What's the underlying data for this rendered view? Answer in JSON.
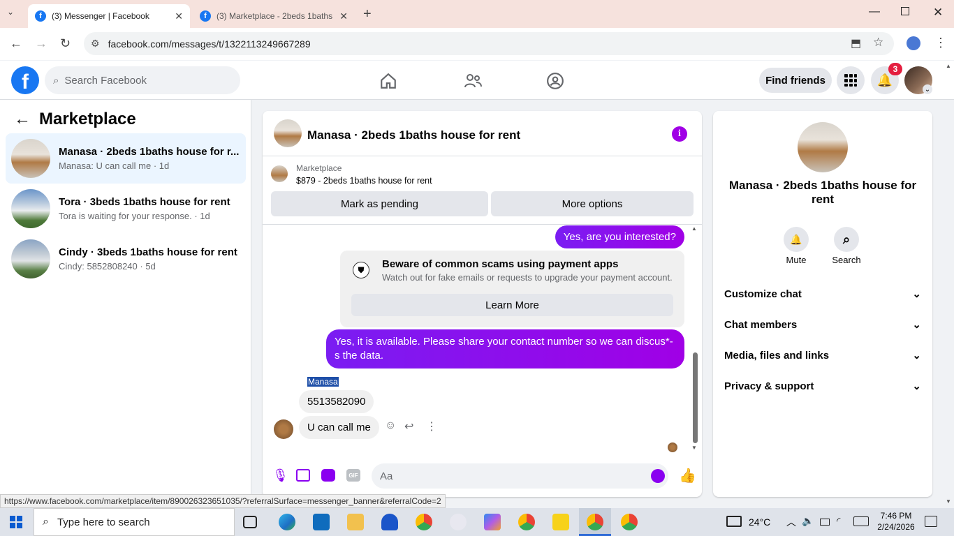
{
  "browser": {
    "tabs": [
      {
        "title": "(3) Messenger | Facebook"
      },
      {
        "title": "(3) Marketplace - 2beds 1baths"
      }
    ],
    "url": "facebook.com/messages/t/1322113249667289",
    "status_url": "https://www.facebook.com/marketplace/item/890026323651035/?referralSurface=messenger_banner&referralCode=2"
  },
  "header": {
    "search_placeholder": "Search Facebook",
    "find_friends": "Find friends",
    "notif_count": "3"
  },
  "left": {
    "title": "Marketplace",
    "conversations": [
      {
        "name": "Manasa · 2beds 1baths house for r...",
        "snippet": "Manasa: U can call me · 1d"
      },
      {
        "name": "Tora · 3beds 1baths house for rent",
        "snippet": "Tora is waiting for your response. · 1d"
      },
      {
        "name": "Cindy · 3beds 1baths house for rent",
        "snippet": "Cindy: 5852808240 · 5d"
      }
    ]
  },
  "chat": {
    "title": "Manasa · 2beds 1baths house for rent",
    "banner_label": "Marketplace",
    "banner_listing": "$879 - 2beds 1baths house for rent",
    "mark_pending": "Mark as pending",
    "more_options": "More options",
    "msg1": "Yes, are you interested?",
    "scam_title": "Beware of common scams using payment apps",
    "scam_body": "Watch out for fake emails or requests to upgrade your payment account.",
    "learn_more": "Learn More",
    "msg2": "Yes, it is available. Please share your contact number so we can discus*-s the data.",
    "sender": "Manasa",
    "msg3": "5513582090",
    "msg4": "U can call me",
    "composer_placeholder": "Aa"
  },
  "info": {
    "name": "Manasa · 2beds 1baths house for rent",
    "mute": "Mute",
    "search": "Search",
    "sections": [
      "Customize chat",
      "Chat members",
      "Media, files and links",
      "Privacy & support"
    ]
  },
  "taskbar": {
    "search_placeholder": "Type here to search",
    "weather": "24°C",
    "time": "7:46 PM",
    "date": "2/24/2026"
  },
  "colors": {
    "accent": "#1877f2",
    "bubble": "#8a00f0"
  }
}
